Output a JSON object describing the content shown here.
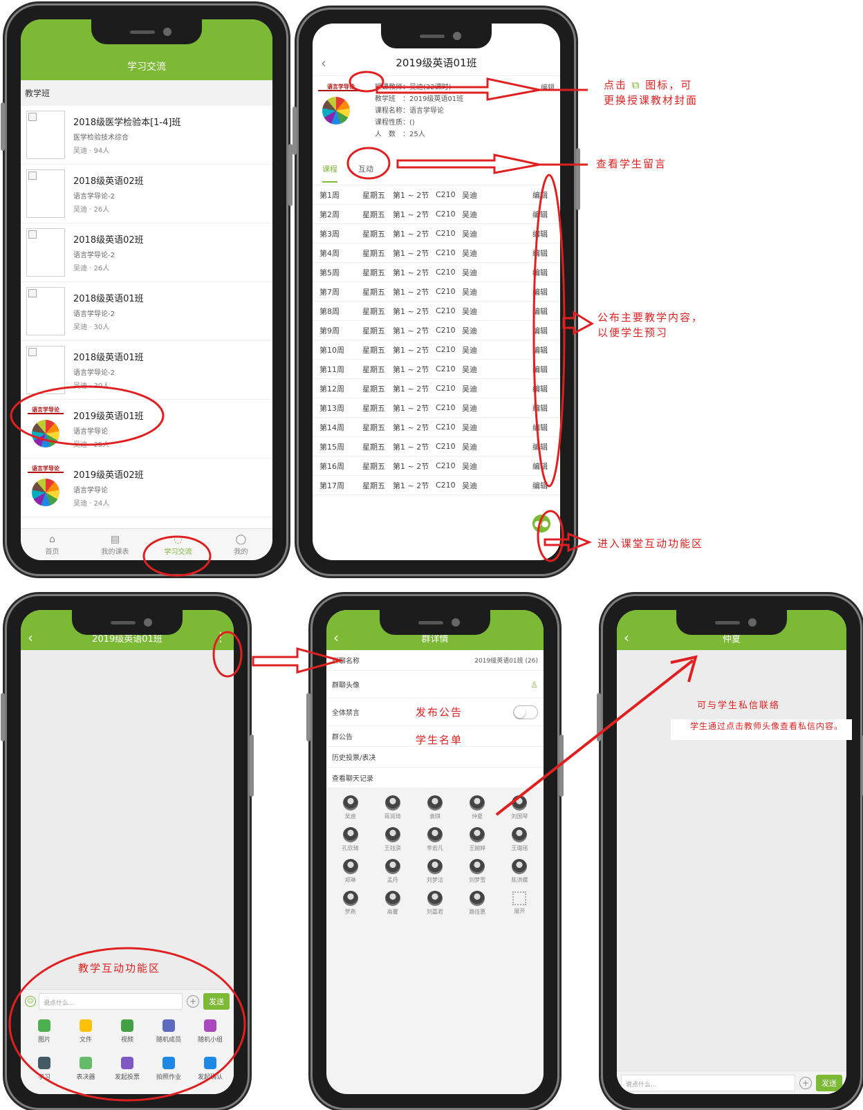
{
  "phone1": {
    "header_title": "学习交流",
    "section_title": "教学班",
    "classes": [
      {
        "name": "2018级医学检验本[1-4]班",
        "course": "医学检验技术综合",
        "meta": "吴迪 · 94人",
        "cover": "broken"
      },
      {
        "name": "2018级英语02班",
        "course": "语言学导论-2",
        "meta": "吴迪 · 26人",
        "cover": "broken"
      },
      {
        "name": "2018级英语02班",
        "course": "语言学导论-2",
        "meta": "吴迪 · 26人",
        "cover": "broken"
      },
      {
        "name": "2018级英语01班",
        "course": "语言学导论-2",
        "meta": "吴迪 · 30人",
        "cover": "broken"
      },
      {
        "name": "2018级英语01班",
        "course": "语言学导论-2",
        "meta": "吴迪 · 30人",
        "cover": "broken"
      },
      {
        "name": "2019级英语01班",
        "course": "语言学导论",
        "meta": "吴迪 · 25人",
        "cover": "book"
      },
      {
        "name": "2019级英语02班",
        "course": "语言学导论",
        "meta": "吴迪 · 24人",
        "cover": "book"
      }
    ],
    "cover_title": "语言学导论",
    "tabbar": [
      {
        "label": "首页",
        "icon": "home-icon"
      },
      {
        "label": "我的课表",
        "icon": "calendar-icon"
      },
      {
        "label": "学习交流",
        "icon": "chat-icon",
        "active": true
      },
      {
        "label": "我的",
        "icon": "user-icon"
      }
    ]
  },
  "phone2": {
    "title": "2019级英语01班",
    "edit_label": "编辑",
    "info": {
      "teacher": "授课教师：吴迪(32课时)",
      "class": "教学班　：2019级英语01班",
      "course": "课程名称：语言学导论",
      "nature": "课程性质：()",
      "count": "人　数　：25人"
    },
    "tabs": [
      "课程",
      "互动"
    ],
    "schedule": [
      {
        "week": "第1周",
        "day": "星期五",
        "period": "第1 ~ 2节",
        "room": "C210",
        "teacher": "吴迪",
        "action": "编辑"
      },
      {
        "week": "第2周",
        "day": "星期五",
        "period": "第1 ~ 2节",
        "room": "C210",
        "teacher": "吴迪",
        "action": "编辑"
      },
      {
        "week": "第3周",
        "day": "星期五",
        "period": "第1 ~ 2节",
        "room": "C210",
        "teacher": "吴迪",
        "action": "编辑"
      },
      {
        "week": "第4周",
        "day": "星期五",
        "period": "第1 ~ 2节",
        "room": "C210",
        "teacher": "吴迪",
        "action": "编辑"
      },
      {
        "week": "第5周",
        "day": "星期五",
        "period": "第1 ~ 2节",
        "room": "C210",
        "teacher": "吴迪",
        "action": "编辑"
      },
      {
        "week": "第7周",
        "day": "星期五",
        "period": "第1 ~ 2节",
        "room": "C210",
        "teacher": "吴迪",
        "action": "编辑"
      },
      {
        "week": "第8周",
        "day": "星期五",
        "period": "第1 ~ 2节",
        "room": "C210",
        "teacher": "吴迪",
        "action": "编辑"
      },
      {
        "week": "第9周",
        "day": "星期五",
        "period": "第1 ~ 2节",
        "room": "C210",
        "teacher": "吴迪",
        "action": "编辑"
      },
      {
        "week": "第10周",
        "day": "星期五",
        "period": "第1 ~ 2节",
        "room": "C210",
        "teacher": "吴迪",
        "action": "编辑"
      },
      {
        "week": "第11周",
        "day": "星期五",
        "period": "第1 ~ 2节",
        "room": "C210",
        "teacher": "吴迪",
        "action": "编辑"
      },
      {
        "week": "第12周",
        "day": "星期五",
        "period": "第1 ~ 2节",
        "room": "C210",
        "teacher": "吴迪",
        "action": "编辑"
      },
      {
        "week": "第13周",
        "day": "星期五",
        "period": "第1 ~ 2节",
        "room": "C210",
        "teacher": "吴迪",
        "action": "编辑"
      },
      {
        "week": "第14周",
        "day": "星期五",
        "period": "第1 ~ 2节",
        "room": "C210",
        "teacher": "吴迪",
        "action": "编辑"
      },
      {
        "week": "第15周",
        "day": "星期五",
        "period": "第1 ~ 2节",
        "room": "C210",
        "teacher": "吴迪",
        "action": "编辑"
      },
      {
        "week": "第16周",
        "day": "星期五",
        "period": "第1 ~ 2节",
        "room": "C210",
        "teacher": "吴迪",
        "action": "编辑"
      },
      {
        "week": "第17周",
        "day": "星期五",
        "period": "第1 ~ 2节",
        "room": "C210",
        "teacher": "吴迪",
        "action": "编辑"
      }
    ]
  },
  "phone3": {
    "title": "2019级英语01班",
    "input_placeholder": "说点什么...",
    "send_label": "发送",
    "tools": [
      {
        "label": "图片",
        "icon": "image-icon",
        "color": "#4caf50"
      },
      {
        "label": "文件",
        "icon": "folder-icon",
        "color": "#ffc107"
      },
      {
        "label": "视频",
        "icon": "video-icon",
        "color": "#43a047"
      },
      {
        "label": "随机成员",
        "icon": "random-member-icon",
        "color": "#5c6bc0"
      },
      {
        "label": "随机小组",
        "icon": "random-group-icon",
        "color": "#ab47bc"
      },
      {
        "label": "学习",
        "icon": "study-icon",
        "color": "#455a64"
      },
      {
        "label": "表决器",
        "icon": "vote-device-icon",
        "color": "#66bb6a"
      },
      {
        "label": "发起投票",
        "icon": "poll-icon",
        "color": "#7e57c2"
      },
      {
        "label": "拍照作业",
        "icon": "photo-homework-icon",
        "color": "#1e88e5"
      },
      {
        "label": "发起确认",
        "icon": "confirm-icon",
        "color": "#1e88e5"
      }
    ]
  },
  "phone4": {
    "title": "群详情",
    "rows": [
      {
        "label": "群聊名称",
        "value": "2019级英语01班 (26)"
      },
      {
        "label": "群聊头像",
        "value": ""
      },
      {
        "label": "全体禁言",
        "value": ""
      },
      {
        "label": "群公告",
        "value": ""
      },
      {
        "label": "历史投票/表决",
        "value": ""
      },
      {
        "label": "查看聊天记录",
        "value": ""
      }
    ],
    "members": [
      "吴迪",
      "蒋润琦",
      "袁琪",
      "仲夏",
      "刘国琴",
      "孔欣琦",
      "王钰淇",
      "李若凡",
      "王婉婷",
      "王璐瑶",
      "郑琳",
      "孟丹",
      "刘梦洁",
      "刘梦雪",
      "陈洪蝶",
      "罗燕",
      "高馨",
      "刘嘉君",
      "路佳惠"
    ],
    "expand_label": "展开"
  },
  "phone5": {
    "title": "仲夏",
    "input_placeholder": "说点什么...",
    "send_label": "发送"
  },
  "annotations": {
    "cover_hint_a": "点击",
    "cover_hint_b": "图标，可",
    "cover_hint_c": "更换授课教材封面",
    "messages_hint": "查看学生留言",
    "content_hint_a": "公布主要教学内容，",
    "content_hint_b": "以便学生预习",
    "interact_hint": "进入课堂互动功能区",
    "publish_notice": "发布公告",
    "student_list": "学生名单",
    "teach_area": "教学互动功能区",
    "private_hint": "可与学生私信联络",
    "private_detail": "学生通过点击教师头像查看私信内容。"
  },
  "colors": {
    "brand_green": "#7cb935",
    "annotation_red": "#e02020"
  }
}
